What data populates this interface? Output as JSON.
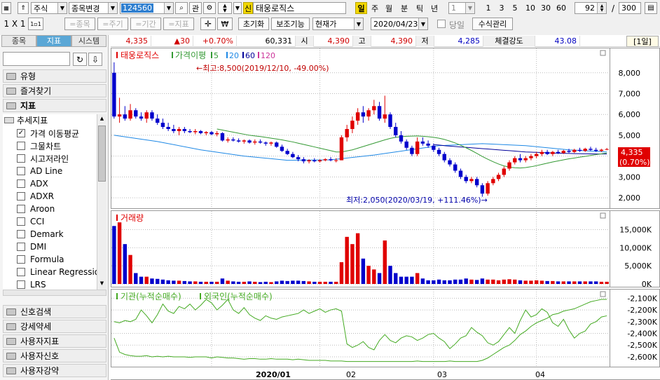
{
  "toolbar": {
    "market": "주식",
    "change_label": "종목변경",
    "code": "124560",
    "gwan": "관",
    "sin_badge": "신",
    "stock_name": "태웅로직스",
    "periods": [
      "일",
      "주",
      "월",
      "분",
      "틱",
      "년"
    ],
    "active_period": "일",
    "min_select": "1",
    "min_options": [
      "1",
      "3",
      "5",
      "10",
      "30",
      "60"
    ],
    "count_value": "92",
    "slash": "/",
    "total_value": "300",
    "layout": "1 X 1",
    "row2_small": "1▫1",
    "row2_buttons": [
      "=종목",
      "=주기",
      "=기간",
      "=지표"
    ],
    "init": "초기화",
    "aux": "보조기능",
    "price_type": "현재가",
    "date": "2020/04/23",
    "today_label": "당일",
    "formula": "수식관리"
  },
  "sidebar": {
    "tabs": [
      "종목",
      "지표",
      "시스템"
    ],
    "active_tab": "지표",
    "categories_top": [
      {
        "label": "유형"
      },
      {
        "label": "즐겨찾기"
      },
      {
        "label": "지표"
      }
    ],
    "tree_header": "추세지표",
    "items": [
      {
        "label": "가격 이동평균",
        "checked": true
      },
      {
        "label": "그물차트",
        "checked": false
      },
      {
        "label": "시고저라인",
        "checked": false
      },
      {
        "label": "AD Line",
        "checked": false
      },
      {
        "label": "ADX",
        "checked": false
      },
      {
        "label": "ADXR",
        "checked": false
      },
      {
        "label": "Aroon",
        "checked": false
      },
      {
        "label": "CCI",
        "checked": false
      },
      {
        "label": "Demark",
        "checked": false
      },
      {
        "label": "DMI",
        "checked": false
      },
      {
        "label": "Formula",
        "checked": false
      },
      {
        "label": "Linear Regression",
        "checked": false
      },
      {
        "label": "LRS",
        "checked": false
      }
    ],
    "categories_bottom": [
      {
        "label": "신호검색"
      },
      {
        "label": "강세약세"
      },
      {
        "label": "사용자지표"
      },
      {
        "label": "사용자신호"
      },
      {
        "label": "사용자강약"
      }
    ]
  },
  "info": {
    "price": "4,335",
    "change": "▲30",
    "change_pct": "+0.70%",
    "volume": "60,331",
    "open_label": "시",
    "open": "4,390",
    "high_label": "고",
    "high": "4,390",
    "low_label": "저",
    "low": "4,285",
    "strength_label": "체결강도",
    "strength": "43.08",
    "period_tag": "[1일]"
  },
  "panels": {
    "price": {
      "title": "태웅로직스",
      "ma_label": "가격이평",
      "ma_periods": [
        "5",
        "20",
        "60",
        "120"
      ],
      "ma_colors": [
        "#339933",
        "#1e88e5",
        "#000099",
        "#cc3399"
      ],
      "high_annotation": "←최고:8,500(2019/12/10, -49.00%)",
      "low_annotation": "최저:2,050(2020/03/19, +111.46%)→",
      "yticks": [
        "8,000",
        "7,000",
        "6,000",
        "5,000",
        "4,000",
        "3,000",
        "2,000"
      ],
      "current_price": "4,335",
      "current_pct": "(0.70%)"
    },
    "volume": {
      "title": "거래량",
      "yticks": [
        "15,000K",
        "10,000K",
        "5,000K",
        "0K"
      ]
    },
    "net": {
      "title1": "기관(누적순매수)",
      "title2": "외국인(누적순매수)",
      "yticks": [
        "-2,100K",
        "-2,200K",
        "-2,300K",
        "-2,400K",
        "-2,500K",
        "-2,600K"
      ]
    },
    "xaxis": [
      "2020/01",
      "02",
      "03",
      "04"
    ]
  },
  "chart_data": {
    "type": "candlestick",
    "y_range": [
      1700,
      8800
    ],
    "volume_range": [
      0,
      18000
    ],
    "net_range": [
      -2660,
      -2080
    ],
    "candles": [
      [
        8000,
        8500,
        5800,
        5900,
        16000
      ],
      [
        5900,
        6800,
        5600,
        6000,
        17000
      ],
      [
        6000,
        6400,
        5700,
        5800,
        11000
      ],
      [
        5800,
        6500,
        5700,
        6200,
        8000
      ],
      [
        6200,
        6300,
        5800,
        5900,
        3000
      ],
      [
        5900,
        6100,
        5700,
        5800,
        2000
      ],
      [
        5800,
        6200,
        5600,
        6100,
        2000
      ],
      [
        6100,
        6200,
        5700,
        5800,
        1500
      ],
      [
        5800,
        6000,
        5500,
        5600,
        1400
      ],
      [
        5600,
        5800,
        5300,
        5400,
        1200
      ],
      [
        5400,
        5600,
        5200,
        5300,
        1000
      ],
      [
        5300,
        5500,
        5100,
        5200,
        900
      ],
      [
        5200,
        5400,
        5000,
        5300,
        900
      ],
      [
        5300,
        5400,
        5100,
        5200,
        800
      ],
      [
        5200,
        5300,
        5100,
        5150,
        700
      ],
      [
        5150,
        5300,
        5050,
        5200,
        700
      ],
      [
        5200,
        5250,
        5050,
        5100,
        600
      ],
      [
        5100,
        5200,
        5000,
        5150,
        600
      ],
      [
        5150,
        5200,
        5000,
        5050,
        600
      ],
      [
        5050,
        5200,
        4950,
        5100,
        600
      ],
      [
        5100,
        5150,
        4700,
        4750,
        1500
      ],
      [
        4750,
        4900,
        4650,
        4800,
        900
      ],
      [
        4800,
        4900,
        4700,
        4750,
        700
      ],
      [
        4750,
        4850,
        4650,
        4700,
        600
      ],
      [
        4700,
        4800,
        4600,
        4750,
        600
      ],
      [
        4750,
        4800,
        4600,
        4650,
        700
      ],
      [
        4650,
        4800,
        4550,
        4700,
        600
      ],
      [
        4700,
        4800,
        4600,
        4650,
        500
      ],
      [
        4650,
        4700,
        4500,
        4600,
        600
      ],
      [
        4600,
        4700,
        4500,
        4650,
        500
      ],
      [
        4650,
        4700,
        4400,
        4450,
        700
      ],
      [
        4450,
        4550,
        4200,
        4250,
        900
      ],
      [
        4250,
        4350,
        4050,
        4100,
        800
      ],
      [
        4100,
        4200,
        3900,
        3950,
        900
      ],
      [
        3950,
        4050,
        3750,
        3850,
        900
      ],
      [
        3850,
        3950,
        3650,
        3750,
        800
      ],
      [
        3750,
        3850,
        3650,
        3800,
        700
      ],
      [
        3800,
        3900,
        3700,
        3750,
        600
      ],
      [
        3750,
        3850,
        3700,
        3800,
        600
      ],
      [
        3800,
        3900,
        3750,
        3850,
        600
      ],
      [
        3850,
        3950,
        3750,
        3800,
        600
      ],
      [
        3800,
        3900,
        3700,
        3800,
        600
      ],
      [
        3800,
        5000,
        3800,
        4900,
        6000
      ],
      [
        4900,
        5500,
        4700,
        5300,
        13000
      ],
      [
        5300,
        5900,
        5100,
        5700,
        11000
      ],
      [
        5700,
        6300,
        5500,
        6100,
        14000
      ],
      [
        6100,
        6400,
        5600,
        5900,
        7000
      ],
      [
        5900,
        6300,
        5700,
        6200,
        5000
      ],
      [
        6200,
        6700,
        6000,
        6400,
        4000
      ],
      [
        6400,
        6600,
        5700,
        5800,
        3000
      ],
      [
        5800,
        6900,
        5600,
        6000,
        12000
      ],
      [
        6000,
        6100,
        5300,
        5400,
        5000
      ],
      [
        5400,
        5600,
        4900,
        5000,
        3000
      ],
      [
        5000,
        5200,
        4600,
        4700,
        2000
      ],
      [
        4700,
        4800,
        4300,
        4400,
        2000
      ],
      [
        4400,
        4500,
        4000,
        4100,
        2000
      ],
      [
        4100,
        4900,
        4000,
        4700,
        3000
      ],
      [
        4700,
        4900,
        4500,
        4600,
        1500
      ],
      [
        4600,
        4750,
        4400,
        4500,
        1000
      ],
      [
        4500,
        4600,
        4200,
        4300,
        1000
      ],
      [
        4300,
        4400,
        4000,
        4100,
        1200
      ],
      [
        4100,
        4200,
        3700,
        3800,
        1000
      ],
      [
        3800,
        3900,
        3500,
        3600,
        1000
      ],
      [
        3600,
        3700,
        3200,
        3300,
        1200
      ],
      [
        3300,
        3400,
        2900,
        3000,
        1200
      ],
      [
        3000,
        3100,
        2700,
        2800,
        1500
      ],
      [
        2800,
        3000,
        2700,
        2900,
        1200
      ],
      [
        2900,
        3000,
        2500,
        2600,
        1100
      ],
      [
        2600,
        2700,
        2050,
        2200,
        1500
      ],
      [
        2200,
        2800,
        2100,
        2700,
        1200
      ],
      [
        2700,
        3000,
        2600,
        2900,
        1200
      ],
      [
        2900,
        3200,
        2800,
        3100,
        1000
      ],
      [
        3100,
        3500,
        3000,
        3400,
        1200
      ],
      [
        3400,
        3800,
        3300,
        3700,
        1300
      ],
      [
        3700,
        4000,
        3600,
        3900,
        1200
      ],
      [
        3900,
        4100,
        3700,
        3800,
        1000
      ],
      [
        3800,
        4000,
        3700,
        3900,
        900
      ],
      [
        3900,
        4100,
        3800,
        4000,
        900
      ],
      [
        4000,
        4200,
        3900,
        4100,
        1000
      ],
      [
        4100,
        4300,
        4000,
        4200,
        900
      ],
      [
        4200,
        4300,
        4050,
        4100,
        800
      ],
      [
        4100,
        4250,
        4000,
        4200,
        800
      ],
      [
        4200,
        4300,
        4100,
        4150,
        700
      ],
      [
        4150,
        4300,
        4100,
        4250,
        700
      ],
      [
        4250,
        4350,
        4150,
        4200,
        700
      ],
      [
        4200,
        4350,
        4150,
        4300,
        700
      ],
      [
        4300,
        4400,
        4200,
        4250,
        700
      ],
      [
        4250,
        4400,
        4200,
        4350,
        700
      ],
      [
        4350,
        4450,
        4250,
        4300,
        700
      ],
      [
        4300,
        4400,
        4200,
        4250,
        700
      ],
      [
        4250,
        4350,
        4200,
        4305,
        600
      ],
      [
        4305,
        4390,
        4285,
        4335,
        600
      ]
    ],
    "ma20": [
      null,
      null,
      null,
      null,
      null,
      null,
      null,
      null,
      null,
      null,
      null,
      null,
      null,
      null,
      null,
      null,
      null,
      null,
      null,
      5300,
      5250,
      5200,
      5150,
      5100,
      5050,
      5000,
      4970,
      4940,
      4900,
      4860,
      4820,
      4780,
      4730,
      4680,
      4620,
      4560,
      4500,
      4440,
      4380,
      4320,
      4260,
      4200,
      4200,
      4250,
      4300,
      4380,
      4460,
      4540,
      4620,
      4700,
      4780,
      4850,
      4900,
      4930,
      4950,
      4960,
      4970,
      4950,
      4930,
      4900,
      4860,
      4800,
      4720,
      4630,
      4520,
      4400,
      4270,
      4130,
      3980,
      3850,
      3730,
      3620,
      3530,
      3470,
      3440,
      3430,
      3450,
      3490,
      3540,
      3600,
      3660,
      3720,
      3770,
      3820,
      3870,
      3910,
      3950,
      3990,
      4030,
      4070,
      4110,
      4150
    ],
    "ma60": [
      null,
      null,
      null,
      null,
      null,
      null,
      null,
      null,
      null,
      null,
      null,
      null,
      null,
      null,
      null,
      null,
      null,
      null,
      null,
      null,
      null,
      null,
      null,
      null,
      null,
      null,
      null,
      null,
      null,
      null,
      null,
      null,
      null,
      null,
      null,
      null,
      null,
      null,
      null,
      null,
      null,
      null,
      null,
      null,
      null,
      null,
      null,
      null,
      null,
      null,
      null,
      null,
      null,
      null,
      null,
      null,
      null,
      null,
      null,
      4550,
      4530,
      4500,
      4480,
      4460,
      4440,
      4420,
      4400,
      4380,
      4360,
      4340,
      4320,
      4300,
      4280,
      4260,
      4240,
      4220,
      4200,
      4190,
      4180,
      4170,
      4160,
      4150,
      4140,
      4130,
      4125,
      4120,
      4115,
      4110,
      4105,
      4100,
      4100,
      4100
    ],
    "ma120_line": [
      [
        0,
        5000
      ],
      [
        8,
        4700
      ],
      [
        16,
        4300
      ],
      [
        24,
        4000
      ],
      [
        32,
        3800
      ],
      [
        40,
        3820
      ],
      [
        48,
        4050
      ],
      [
        56,
        4350
      ],
      [
        60,
        4500
      ],
      [
        68,
        4600
      ],
      [
        76,
        4500
      ],
      [
        84,
        4300
      ],
      [
        91,
        4200
      ]
    ],
    "inst_net": [
      -2300,
      -2310,
      -2290,
      -2300,
      -2280,
      -2200,
      -2250,
      -2310,
      -2240,
      -2150,
      -2210,
      -2230,
      -2170,
      -2190,
      -2150,
      -2200,
      -2160,
      -2110,
      -2140,
      -2200,
      -2160,
      -2110,
      -2200,
      -2230,
      -2180,
      -2240,
      -2270,
      -2290,
      -2250,
      -2270,
      -2280,
      -2260,
      -2250,
      -2240,
      -2230,
      -2200,
      -2230,
      -2210,
      -2190,
      -2220,
      -2200,
      -2190,
      -2210,
      -2490,
      -2520,
      -2500,
      -2470,
      -2520,
      -2540,
      -2460,
      -2410,
      -2460,
      -2480,
      -2440,
      -2420,
      -2430,
      -2460,
      -2440,
      -2410,
      -2400,
      -2440,
      -2470,
      -2530,
      -2490,
      -2440,
      -2420,
      -2350,
      -2390,
      -2420,
      -2480,
      -2500,
      -2470,
      -2410,
      -2350,
      -2400,
      -2290,
      -2200,
      -2260,
      -2240,
      -2190,
      -2220,
      -2310,
      -2340,
      -2280,
      -2370,
      -2440,
      -2400,
      -2380,
      -2320,
      -2300,
      -2260,
      -2250
    ],
    "frgn_net": [
      -2440,
      -2560,
      -2580,
      -2590,
      -2595,
      -2595,
      -2590,
      -2600,
      -2595,
      -2600,
      -2595,
      -2600,
      -2600,
      -2600,
      -2605,
      -2600,
      -2600,
      -2600,
      -2610,
      -2600,
      -2605,
      -2610,
      -2610,
      -2615,
      -2620,
      -2615,
      -2615,
      -2620,
      -2620,
      -2615,
      -2620,
      -2620,
      -2620,
      -2625,
      -2620,
      -2625,
      -2630,
      -2630,
      -2630,
      -2630,
      -2635,
      -2635,
      -2635,
      -2640,
      -2640,
      -2640,
      -2640,
      -2640,
      -2640,
      -2640,
      -2640,
      -2640,
      -2640,
      -2640,
      -2640,
      -2640,
      -2635,
      -2640,
      -2640,
      -2640,
      -2640,
      -2640,
      -2635,
      -2640,
      -2640,
      -2640,
      -2640,
      -2640,
      -2630,
      -2610,
      -2580,
      -2550,
      -2520,
      -2500,
      -2460,
      -2410,
      -2380,
      -2340,
      -2310,
      -2290,
      -2270,
      -2240,
      -2230,
      -2210,
      -2200,
      -2190,
      -2170,
      -2150,
      -2130,
      -2120,
      -2110,
      -2110
    ]
  }
}
